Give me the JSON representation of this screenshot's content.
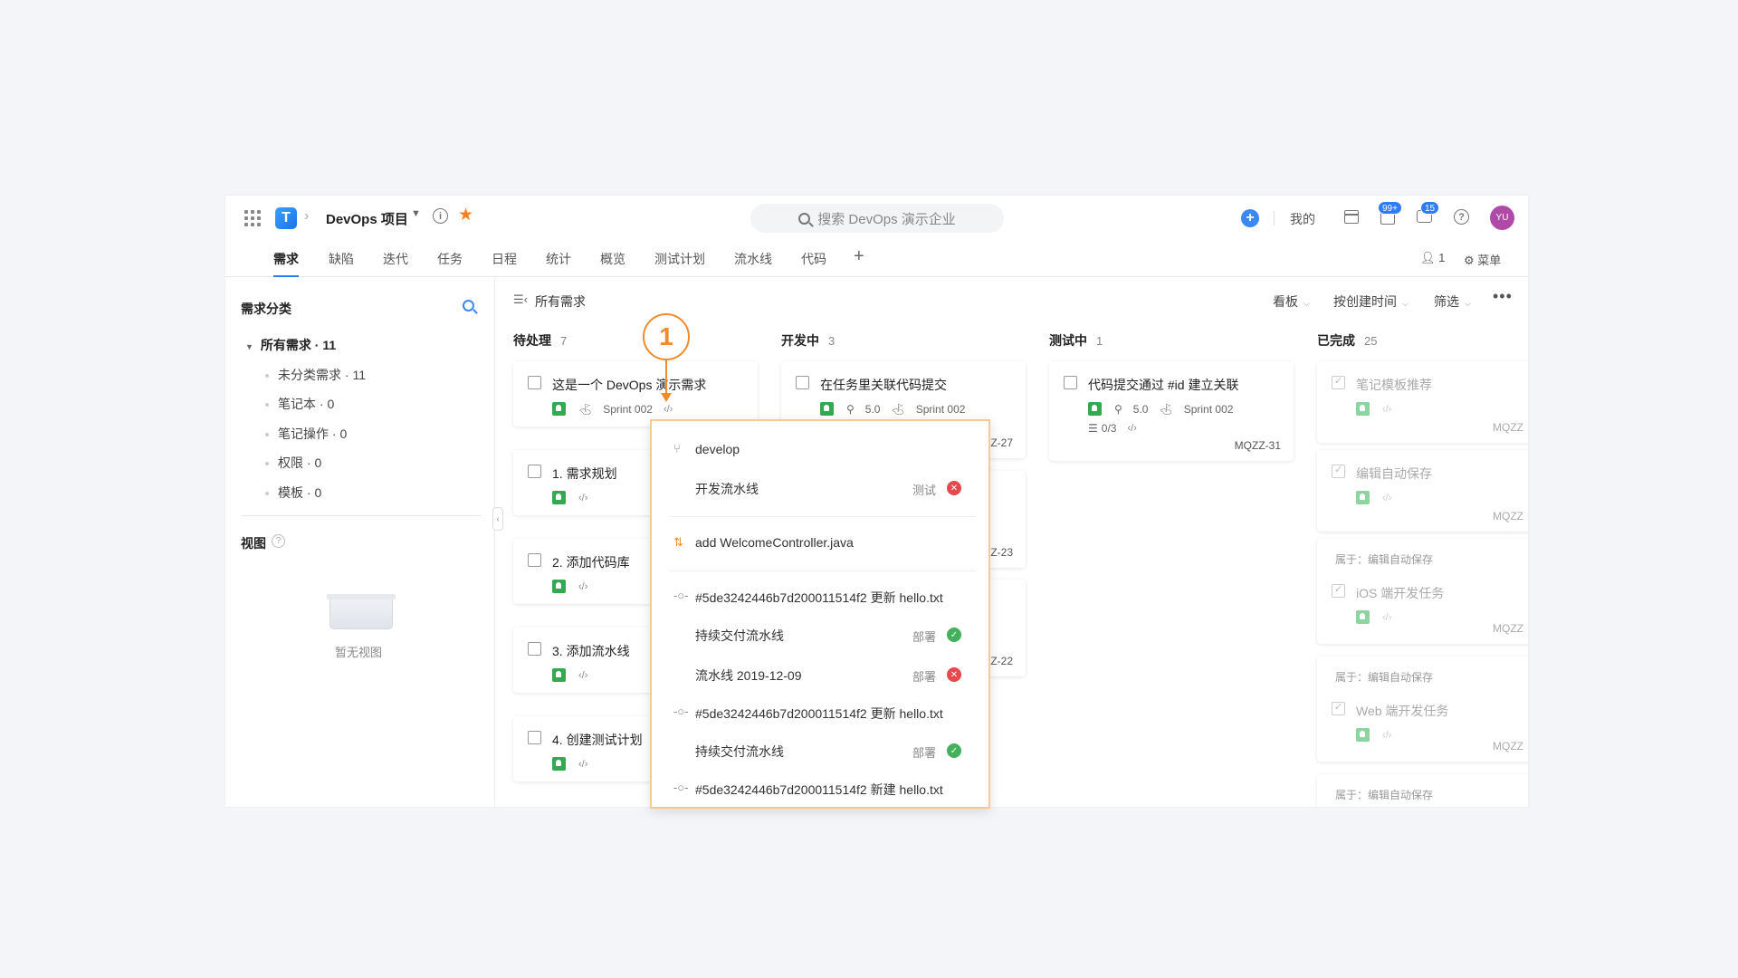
{
  "header": {
    "project_name": "DevOps 项目",
    "search_placeholder": "搜索 DevOps 演示企业",
    "mine_label": "我的",
    "notif_badge": "99+",
    "msg_badge": "15",
    "avatar_text": "YU"
  },
  "tabs": [
    "需求",
    "缺陷",
    "迭代",
    "任务",
    "日程",
    "统计",
    "概览",
    "测试计划",
    "流水线",
    "代码"
  ],
  "toolbar_right": {
    "members": "1",
    "menu": "菜单"
  },
  "sidebar": {
    "title": "需求分类",
    "all_label": "所有需求 · 11",
    "items": [
      "未分类需求 · 11",
      "笔记本 · 0",
      "笔记操作 · 0",
      "权限 · 0",
      "模板 · 0"
    ],
    "view_title": "视图",
    "empty_view": "暂无视图"
  },
  "board": {
    "title": "所有需求",
    "view_mode": "看板",
    "sort": "按创建时间",
    "filter": "筛选"
  },
  "columns": [
    {
      "name": "待处理",
      "count": "7"
    },
    {
      "name": "开发中",
      "count": "3"
    },
    {
      "name": "测试中",
      "count": "1"
    },
    {
      "name": "已完成",
      "count": "25"
    }
  ],
  "cards_todo": [
    {
      "title": "这是一个 DevOps 演示需求",
      "sprint": "Sprint 002"
    },
    {
      "title": "1. 需求规划"
    },
    {
      "title": "2. 添加代码库"
    },
    {
      "title": "3. 添加流水线"
    },
    {
      "title": "4. 创建测试计划"
    }
  ],
  "cards_dev": [
    {
      "title": "在任务里关联代码提交",
      "points": "5.0",
      "sprint": "Sprint 002",
      "id": "ZZ-27"
    },
    {
      "id": "ZZ-23"
    },
    {
      "id": "ZZ-22"
    }
  ],
  "cards_test": [
    {
      "title": "代码提交通过 #id 建立关联",
      "points": "5.0",
      "sprint": "Sprint 002",
      "subtasks": "0/3",
      "id": "MQZZ-31"
    }
  ],
  "cards_done": [
    {
      "title": "笔记模板推荐",
      "id": "MQZZ"
    },
    {
      "title": "编辑自动保存",
      "id": "MQZZ"
    },
    {
      "parent": "属于：编辑自动保存",
      "title": "iOS 端开发任务",
      "id": "MQZZ"
    },
    {
      "parent": "属于：编辑自动保存",
      "title": "Web 端开发任务",
      "id": "MQZZ"
    },
    {
      "parent": "属于：编辑自动保存"
    }
  ],
  "popup": {
    "branch": "develop",
    "pipeline1": {
      "name": "开发流水线",
      "stage": "测试",
      "status": "failed"
    },
    "commit1": "add WelcomeController.java",
    "commit2": "#5de3242446b7d200011514f2 更新 hello.txt",
    "pipeline2": {
      "name": "持续交付流水线",
      "stage": "部署",
      "status": "success"
    },
    "pipeline3": {
      "name": "流水线 2019-12-09",
      "stage": "部署",
      "status": "failed"
    },
    "commit3": "#5de3242446b7d200011514f2 更新 hello.txt",
    "pipeline4": {
      "name": "持续交付流水线",
      "stage": "部署",
      "status": "success"
    },
    "commit4": "#5de3242446b7d200011514f2 新建 hello.txt"
  },
  "annotation": {
    "number": "1",
    "color": "#f08c2c"
  },
  "colors": {
    "accent": "#2f7cf6",
    "tag": "#35a853",
    "fail": "#e5484d",
    "ok": "#43b05c",
    "star": "#f5821f"
  }
}
